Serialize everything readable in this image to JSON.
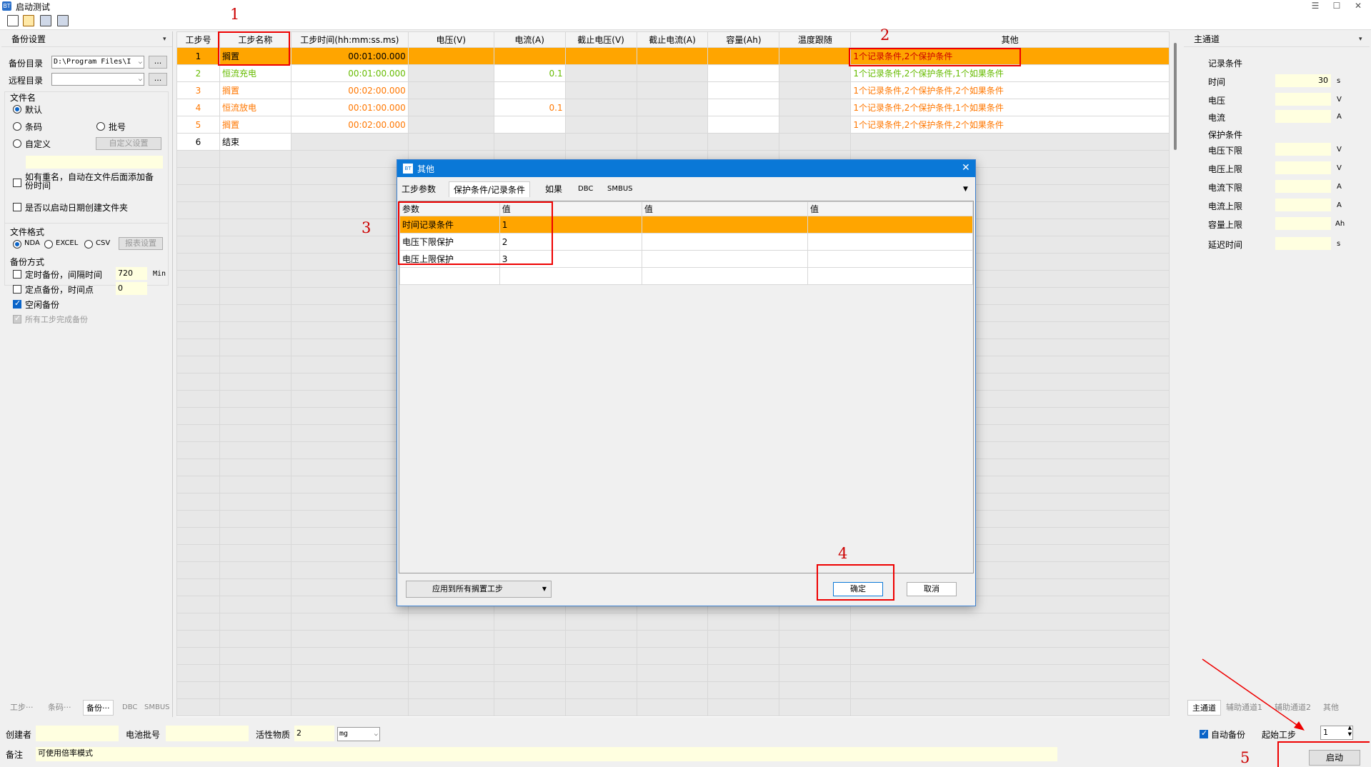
{
  "window": {
    "title": "启动测试",
    "icon_label": "BT",
    "min": "☰",
    "max": "☐",
    "close": "✕"
  },
  "left": {
    "header": "备份设置",
    "pin": "▾",
    "backup_dir_label": "备份目录",
    "backup_dir_value": "D:\\Program Files\\I",
    "remote_dir_label": "远程目录",
    "remote_dir_value": "",
    "browse": "...",
    "file_name_group": "文件名",
    "opt_default": "默认",
    "opt_barcode": "条码",
    "opt_batch": "批号",
    "opt_custom": "自定义",
    "custom_btn": "自定义设置",
    "dup_rename": "如有重名，自动在文件后面添加备份时间",
    "date_folder": "是否以启动日期创建文件夹",
    "file_format_group": "文件格式",
    "fmt_nda": "NDA",
    "fmt_excel": "EXCEL",
    "fmt_csv": "CSV",
    "report_btn": "报表设置",
    "backup_mode_group": "备份方式",
    "timed_backup": "定时备份，间隔时间",
    "timed_value": "720",
    "timed_unit": "Min",
    "fixed_backup": "定点备份，时间点",
    "fixed_value": "0",
    "idle_backup": "空闲备份",
    "all_steps_backup": "所有工步完成备份"
  },
  "bottom_tabs_left": [
    "工步···",
    "条码···",
    "备份···",
    "DBC",
    "SMBUS"
  ],
  "grid": {
    "headers": [
      "工步号",
      "工步名称",
      "工步时间(hh:mm:ss.ms)",
      "电压(V)",
      "电流(A)",
      "截止电压(V)",
      "截止电流(A)",
      "容量(Ah)",
      "温度跟随",
      "其他"
    ],
    "rows": [
      {
        "no": "1",
        "name": "搁置",
        "time": "00:01:00.000",
        "current": "",
        "other": "1个记录条件,2个保护条件"
      },
      {
        "no": "2",
        "name": "恒流充电",
        "time": "00:01:00.000",
        "current": "0.1",
        "other": "1个记录条件,2个保护条件,1个如果条件"
      },
      {
        "no": "3",
        "name": "搁置",
        "time": "00:02:00.000",
        "current": "",
        "other": "1个记录条件,2个保护条件,2个如果条件"
      },
      {
        "no": "4",
        "name": "恒流放电",
        "time": "00:01:00.000",
        "current": "0.1",
        "other": "1个记录条件,2个保护条件,1个如果条件"
      },
      {
        "no": "5",
        "name": "搁置",
        "time": "00:02:00.000",
        "current": "",
        "other": "1个记录条件,2个保护条件,2个如果条件"
      },
      {
        "no": "6",
        "name": "结束",
        "time": "",
        "current": "",
        "other": ""
      }
    ]
  },
  "right": {
    "header": "主通道",
    "record_group": "记录条件",
    "time_label": "时间",
    "time_value": "30",
    "time_unit": "s",
    "voltage_label": "电压",
    "voltage_unit": "V",
    "current_label": "电流",
    "current_unit": "A",
    "protect_group": "保护条件",
    "v_low": "电压下限",
    "v_high": "电压上限",
    "i_low": "电流下限",
    "i_high": "电流上限",
    "cap_high": "容量上限",
    "cap_unit": "Ah",
    "delay": "延迟时间",
    "delay_unit": "s"
  },
  "bottom_tabs_right": [
    "主通道",
    "辅助通道1",
    "辅助通道2",
    "其他"
  ],
  "bottom": {
    "creator_label": "创建者",
    "battery_batch_label": "电池批号",
    "active_label": "活性物质",
    "active_value": "2",
    "active_unit": "mg",
    "note_label": "备注",
    "note_value": "可使用倍率模式",
    "auto_backup": "自动备份",
    "start_step_label": "起始工步",
    "start_step_value": "1",
    "start_button": "启动"
  },
  "dialog": {
    "title": "其他",
    "icon_label": "BT",
    "close": "✕",
    "tabs": [
      "工步参数",
      "保护条件/记录条件",
      "如果",
      "DBC",
      "SMBUS"
    ],
    "tab_menu": "▼",
    "columns": [
      "参数",
      "值",
      "值",
      "值"
    ],
    "rows": [
      {
        "param": "时间记录条件",
        "value": "1"
      },
      {
        "param": "电压下限保护",
        "value": "2"
      },
      {
        "param": "电压上限保护",
        "value": "3"
      }
    ],
    "apply_all": "应用到所有搁置工步",
    "ok": "确定",
    "cancel": "取消"
  },
  "annotations": [
    "1",
    "2",
    "3",
    "4",
    "5"
  ],
  "colors": {
    "selected_row": "#ffa500",
    "green_text": "#66bb00",
    "orange_text": "#ff7700",
    "red_box": "#ee0000",
    "input_yellow": "#ffffe0"
  }
}
